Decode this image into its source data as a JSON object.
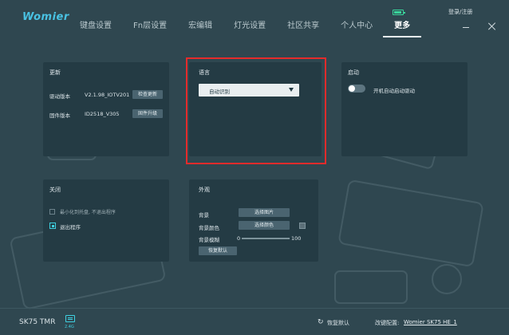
{
  "app": {
    "logo": "Womier",
    "login": "登录/注册",
    "battery_color": "#39d39a"
  },
  "nav": {
    "items": [
      {
        "label": "键盘设置"
      },
      {
        "label": "Fn层设置"
      },
      {
        "label": "宏编辑"
      },
      {
        "label": "灯光设置"
      },
      {
        "label": "社区共享"
      },
      {
        "label": "个人中心"
      },
      {
        "label": "更多"
      }
    ],
    "active": "更多"
  },
  "update": {
    "title": "更新",
    "driver_label": "驱动版本",
    "driver_version": "V2.1.98_IOTV201",
    "check_button": "检查更新",
    "firmware_label": "固件版本",
    "firmware_version": "ID2518_V305",
    "upgrade_button": "固件升级"
  },
  "language": {
    "title": "语言",
    "selected": "自动识别",
    "highlight_color": "#e52b2b"
  },
  "startup": {
    "title": "启动",
    "toggle_label": "开机自动启动驱动",
    "toggle_on": false
  },
  "close": {
    "title": "关闭",
    "option_minimize": "最小化到托盘, 不退出程序",
    "option_exit": "退出程序",
    "selected": "退出程序"
  },
  "appearance": {
    "title": "外观",
    "bg_label": "背景",
    "select_image_button": "选择图片",
    "bg_color_label": "背景颜色",
    "select_color_button": "选择颜色",
    "blur_label": "背景模糊",
    "blur_min": "0",
    "blur_max": "100",
    "blur_value": 0,
    "reset_button": "恢复默认"
  },
  "footer": {
    "device": "SK75 TMR",
    "connection": "2.4G",
    "restore": "恢复默认",
    "config_label": "改键配置:",
    "config_value": "Womier SK75 HE_1"
  }
}
